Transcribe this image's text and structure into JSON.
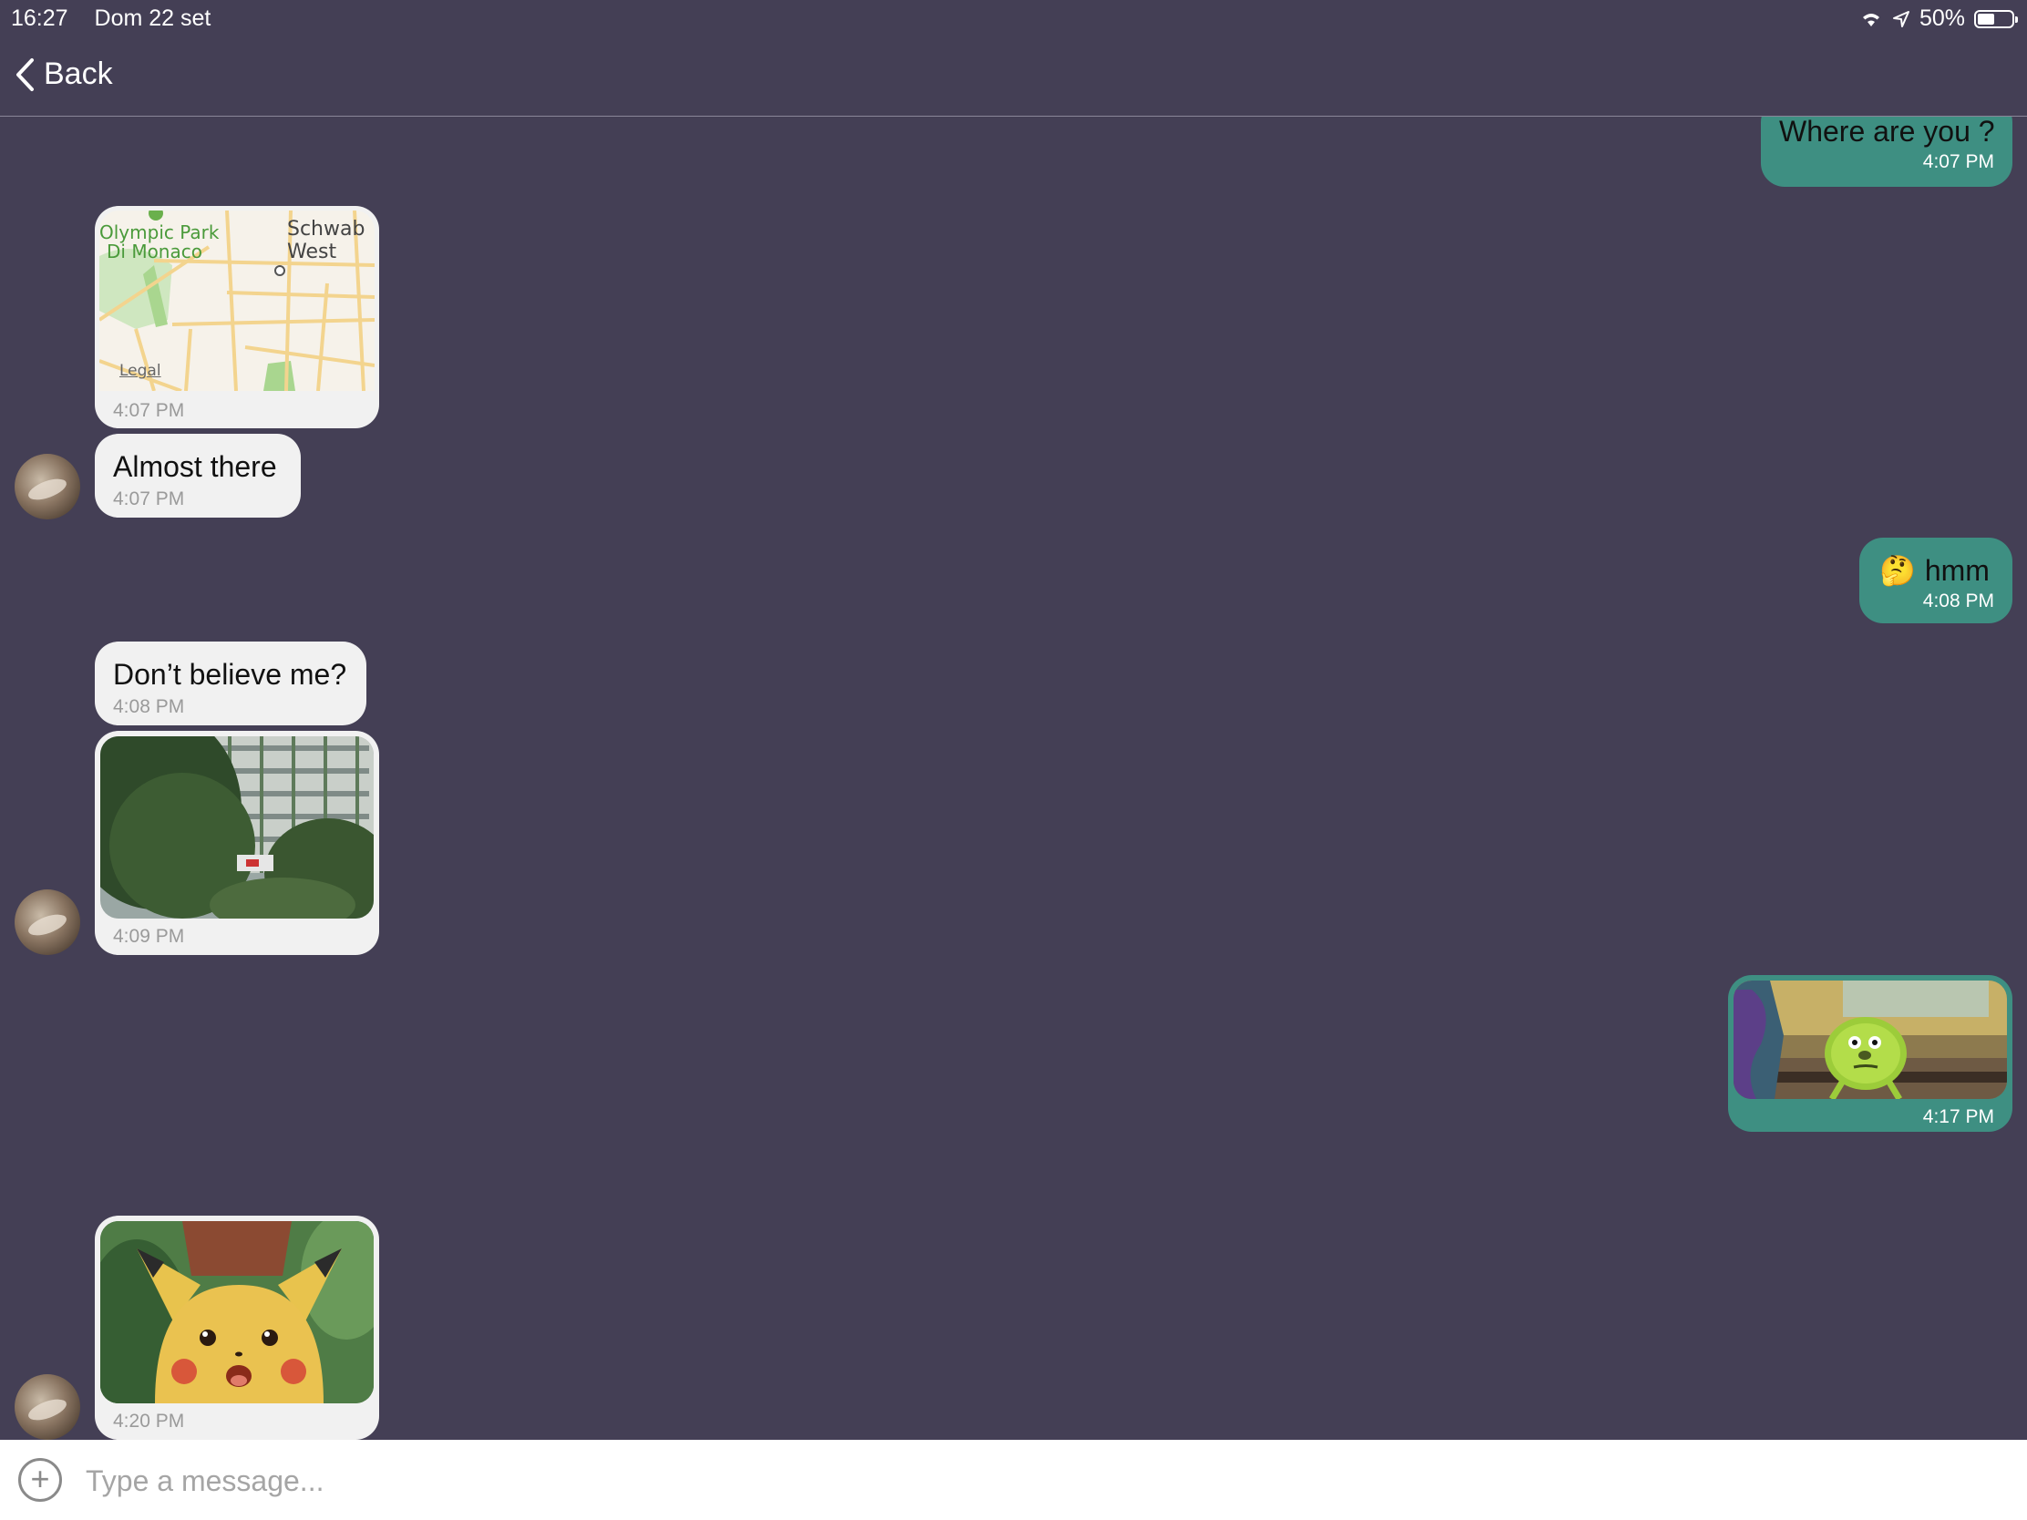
{
  "status_bar": {
    "time": "16:27",
    "date": "Dom 22 set",
    "battery": "50%",
    "battery_level": 0.5
  },
  "nav": {
    "back_label": "Back"
  },
  "messages": [
    {
      "type": "text",
      "side": "sent",
      "text": "Where are you ?",
      "time": "4:07 PM"
    },
    {
      "type": "map",
      "side": "received",
      "time": "4:07 PM",
      "map_labels": {
        "park_line1": "Olympic Park",
        "park_line2": "Di Monaco",
        "area_line1": "Schwab",
        "area_line2": "West",
        "legal": "Legal"
      }
    },
    {
      "type": "text",
      "side": "received",
      "text": "Almost there",
      "time": "4:07 PM"
    },
    {
      "type": "text",
      "side": "sent",
      "emoji": "🤔",
      "text": "hmm",
      "time": "4:08 PM"
    },
    {
      "type": "text",
      "side": "received",
      "text": "Don’t believe me?",
      "time": "4:08 PM"
    },
    {
      "type": "image",
      "side": "received",
      "image": "trees-and-building-photo",
      "time": "4:09 PM"
    },
    {
      "type": "image",
      "side": "sent",
      "image": "green-monster-meme",
      "time": "4:17 PM"
    },
    {
      "type": "image",
      "side": "received",
      "image": "surprised-pikachu-meme",
      "time": "4:20 PM"
    }
  ],
  "composer": {
    "placeholder": "Type a message..."
  },
  "colors": {
    "background": "#443f55",
    "sent_bubble": "#3e8f82",
    "received_bubble": "#f1f1f1"
  }
}
